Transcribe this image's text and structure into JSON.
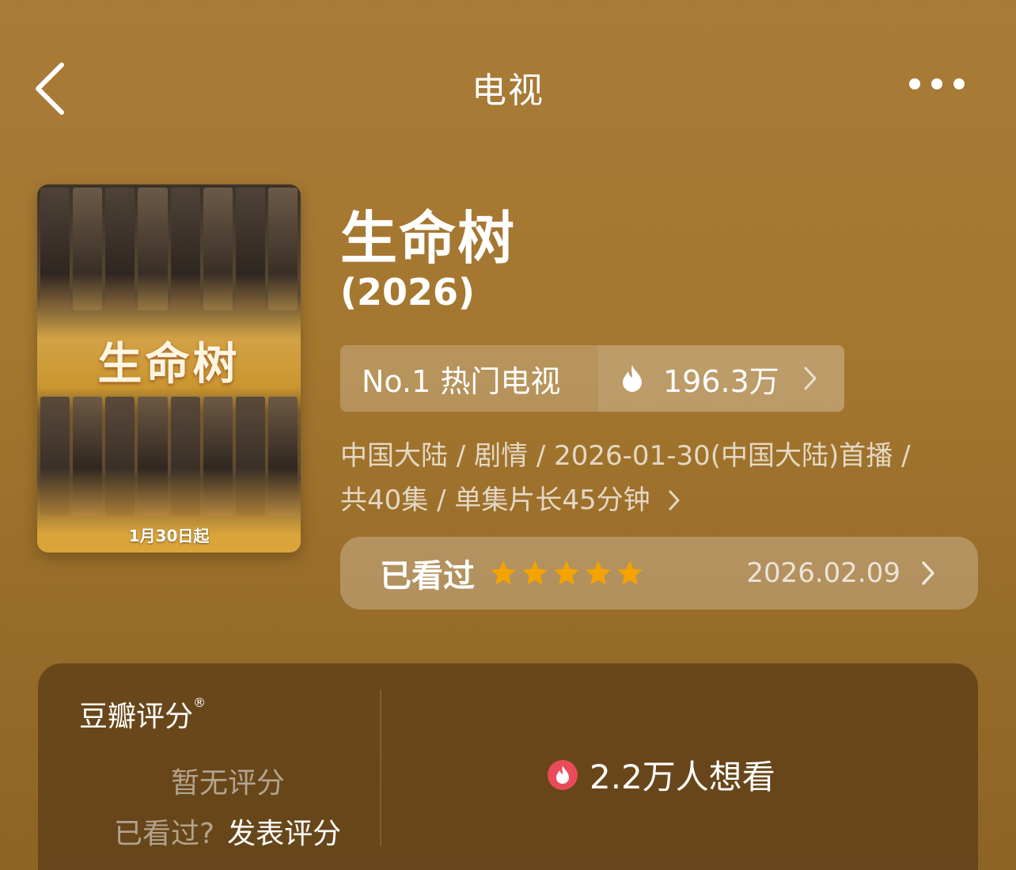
{
  "nav": {
    "title": "电视"
  },
  "poster": {
    "title_art": "生命树",
    "date_text": "1月30日起"
  },
  "show": {
    "title": "生命树",
    "year": "(2026)"
  },
  "rank": {
    "label": "No.1 热门电视",
    "heat": "196.3万"
  },
  "meta": {
    "line1": "中国大陆 / 剧情 / 2026-01-30(中国大陆)首播 /",
    "line2": "共40集 / 单集片长45分钟"
  },
  "watched": {
    "label": "已看过",
    "stars": 5,
    "star_color": "#f5a300",
    "date": "2026.02.09"
  },
  "rating": {
    "label": "豆瓣评分",
    "registered_mark": "®",
    "no_score": "暂无评分",
    "question": "已看过?",
    "action": "发表评分",
    "want_count": "2.2万人想看",
    "want_icon_color": "#e94b5b"
  }
}
